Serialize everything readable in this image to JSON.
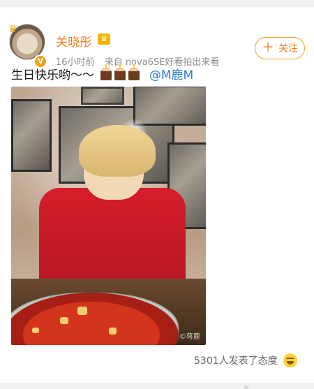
{
  "post": {
    "author": {
      "name": "关晓彤",
      "vip_badge_icon": "crown-icon",
      "verified_badge_icon": "v-badge-icon"
    },
    "meta": {
      "time": "16小时前",
      "source": "来自 nova6SE好看拍出来看"
    },
    "follow_button": {
      "label": "关注",
      "icon": "plus-icon"
    },
    "text": {
      "prefix": "生日快乐哟～～",
      "emoji": [
        "cake-icon",
        "cake-icon",
        "cake-icon"
      ],
      "mention": "@M鹿M"
    },
    "image": {
      "watermark": "©蒋鹿"
    },
    "reactions": {
      "text": "5301人发表了态度",
      "emoji_icon": "laugh-emoji-icon"
    }
  },
  "theme": {
    "accent_orange": "#F07C17",
    "badge_gold": "#F2B400",
    "link_blue": "#2D7BD6",
    "meta_gray": "#8C8C8C",
    "text_dark": "#1A1A1A"
  }
}
